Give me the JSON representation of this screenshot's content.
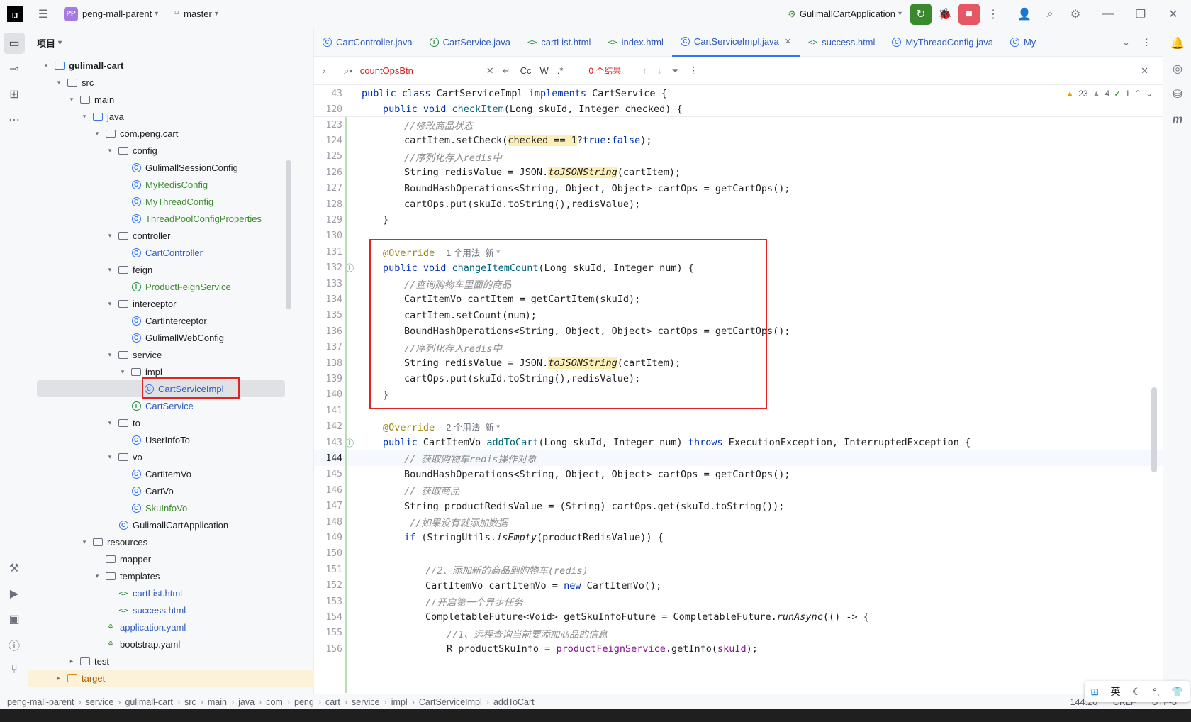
{
  "titlebar": {
    "project": "peng-mall-parent",
    "project_badge": "PP",
    "branch": "master",
    "run_config": "GulimallCartApplication"
  },
  "project_panel": {
    "title": "项目"
  },
  "tree": [
    {
      "label": "gulimall-cart",
      "depth": 0,
      "arrow": "v",
      "icon": "module",
      "cls": "bold"
    },
    {
      "label": "src",
      "depth": 1,
      "arrow": "v",
      "icon": "folder",
      "cls": ""
    },
    {
      "label": "main",
      "depth": 2,
      "arrow": "v",
      "icon": "folder",
      "cls": ""
    },
    {
      "label": "java",
      "depth": 3,
      "arrow": "v",
      "icon": "folder-blue",
      "cls": ""
    },
    {
      "label": "com.peng.cart",
      "depth": 4,
      "arrow": "v",
      "icon": "package",
      "cls": ""
    },
    {
      "label": "config",
      "depth": 5,
      "arrow": "v",
      "icon": "package",
      "cls": ""
    },
    {
      "label": "GulimallSessionConfig",
      "depth": 6,
      "arrow": "",
      "icon": "class",
      "cls": ""
    },
    {
      "label": "MyRedisConfig",
      "depth": 6,
      "arrow": "",
      "icon": "class",
      "cls": "green"
    },
    {
      "label": "MyThreadConfig",
      "depth": 6,
      "arrow": "",
      "icon": "class",
      "cls": "green"
    },
    {
      "label": "ThreadPoolConfigProperties",
      "depth": 6,
      "arrow": "",
      "icon": "class",
      "cls": "green"
    },
    {
      "label": "controller",
      "depth": 5,
      "arrow": "v",
      "icon": "package",
      "cls": ""
    },
    {
      "label": "CartController",
      "depth": 6,
      "arrow": "",
      "icon": "class",
      "cls": "blue"
    },
    {
      "label": "feign",
      "depth": 5,
      "arrow": "v",
      "icon": "package",
      "cls": ""
    },
    {
      "label": "ProductFeignService",
      "depth": 6,
      "arrow": "",
      "icon": "interface",
      "cls": "green"
    },
    {
      "label": "interceptor",
      "depth": 5,
      "arrow": "v",
      "icon": "package",
      "cls": ""
    },
    {
      "label": "CartInterceptor",
      "depth": 6,
      "arrow": "",
      "icon": "class",
      "cls": ""
    },
    {
      "label": "GulimallWebConfig",
      "depth": 6,
      "arrow": "",
      "icon": "class",
      "cls": ""
    },
    {
      "label": "service",
      "depth": 5,
      "arrow": "v",
      "icon": "package",
      "cls": ""
    },
    {
      "label": "impl",
      "depth": 6,
      "arrow": "v",
      "icon": "package",
      "cls": ""
    },
    {
      "label": "CartServiceImpl",
      "depth": 7,
      "arrow": "",
      "icon": "class",
      "cls": "blue selected"
    },
    {
      "label": "CartService",
      "depth": 6,
      "arrow": "",
      "icon": "interface",
      "cls": "blue"
    },
    {
      "label": "to",
      "depth": 5,
      "arrow": "v",
      "icon": "package",
      "cls": ""
    },
    {
      "label": "UserInfoTo",
      "depth": 6,
      "arrow": "",
      "icon": "class",
      "cls": ""
    },
    {
      "label": "vo",
      "depth": 5,
      "arrow": "v",
      "icon": "package",
      "cls": ""
    },
    {
      "label": "CartItemVo",
      "depth": 6,
      "arrow": "",
      "icon": "class",
      "cls": ""
    },
    {
      "label": "CartVo",
      "depth": 6,
      "arrow": "",
      "icon": "class",
      "cls": ""
    },
    {
      "label": "SkuInfoVo",
      "depth": 6,
      "arrow": "",
      "icon": "class",
      "cls": "green"
    },
    {
      "label": "GulimallCartApplication",
      "depth": 5,
      "arrow": "",
      "icon": "class",
      "cls": ""
    },
    {
      "label": "resources",
      "depth": 3,
      "arrow": "v",
      "icon": "folder",
      "cls": ""
    },
    {
      "label": "mapper",
      "depth": 4,
      "arrow": "",
      "icon": "folder",
      "cls": ""
    },
    {
      "label": "templates",
      "depth": 4,
      "arrow": "v",
      "icon": "folder",
      "cls": ""
    },
    {
      "label": "cartList.html",
      "depth": 5,
      "arrow": "",
      "icon": "html",
      "cls": "blue"
    },
    {
      "label": "success.html",
      "depth": 5,
      "arrow": "",
      "icon": "html",
      "cls": "blue"
    },
    {
      "label": "application.yaml",
      "depth": 4,
      "arrow": "",
      "icon": "yaml",
      "cls": "blue"
    },
    {
      "label": "bootstrap.yaml",
      "depth": 4,
      "arrow": "",
      "icon": "yaml",
      "cls": ""
    },
    {
      "label": "test",
      "depth": 2,
      "arrow": ">",
      "icon": "folder",
      "cls": ""
    },
    {
      "label": "target",
      "depth": 1,
      "arrow": ">",
      "icon": "folder-orange",
      "cls": "orange target"
    }
  ],
  "tabs": [
    {
      "label": "CartController.java",
      "icon": "C"
    },
    {
      "label": "CartService.java",
      "icon": "I"
    },
    {
      "label": "cartList.html",
      "icon": "<>"
    },
    {
      "label": "index.html",
      "icon": "<>"
    },
    {
      "label": "CartServiceImpl.java",
      "icon": "C",
      "active": true
    },
    {
      "label": "success.html",
      "icon": "<>"
    },
    {
      "label": "MyThreadConfig.java",
      "icon": "C"
    },
    {
      "label": "My",
      "icon": "C"
    }
  ],
  "search": {
    "query": "countOpsBtn",
    "results": "0 个结果",
    "opt_case": "Cc",
    "opt_word": "W",
    "opt_regex": ".*"
  },
  "inspections": {
    "warnings": "23",
    "weak": "4",
    "ok": "1"
  },
  "code_lines": [
    {
      "n": "43",
      "html": "<span class='kw'>public class</span> CartServiceImpl <span class='kw'>implements</span> CartService {",
      "indent": 0
    },
    {
      "n": "120",
      "html": "<span class='kw'>public void</span> <span class='fn'>checkItem</span>(Long skuId, Integer checked) {",
      "indent": 1
    },
    {
      "n": "123",
      "html": "<span class='cm'>//修改商品状态</span>",
      "indent": 2
    },
    {
      "n": "124",
      "html": "cartItem.setCheck(<span class='strhl'>checked == 1</span>?<span class='kw'>true</span>:<span class='kw'>false</span>);",
      "indent": 2
    },
    {
      "n": "125",
      "html": "<span class='cm'>//序列化存入redis中</span>",
      "indent": 2
    },
    {
      "n": "126",
      "html": "String redisValue = JSON.<span class='it strhl'>toJSONString</span>(cartItem);",
      "indent": 2
    },
    {
      "n": "127",
      "html": "BoundHashOperations&lt;String, Object, Object&gt; cartOps = getCartOps();",
      "indent": 2
    },
    {
      "n": "128",
      "html": "cartOps.put(skuId.toString(),redisValue);",
      "indent": 2
    },
    {
      "n": "129",
      "html": "}",
      "indent": 1
    },
    {
      "n": "130",
      "html": "",
      "indent": 0
    },
    {
      "n": "131",
      "html": "<span class='an'>@Override</span>  <span class='hint'>1 个用法  新 *</span>",
      "indent": 1
    },
    {
      "n": "132",
      "html": "<span class='kw'>public void</span> <span class='fn'>changeItemCount</span>(Long skuId, Integer num) {",
      "indent": 1
    },
    {
      "n": "133",
      "html": "<span class='cm'>//查询购物车里面的商品</span>",
      "indent": 2
    },
    {
      "n": "134",
      "html": "CartItemVo cartItem = getCartItem(skuId);",
      "indent": 2
    },
    {
      "n": "135",
      "html": "cartItem.setCount(num);",
      "indent": 2
    },
    {
      "n": "136",
      "html": "BoundHashOperations&lt;String, Object, Object&gt; cartOps = getCartOps();",
      "indent": 2
    },
    {
      "n": "137",
      "html": "<span class='cm'>//序列化存入redis中</span>",
      "indent": 2
    },
    {
      "n": "138",
      "html": "String redisValue = JSON.<span class='it strhl'>toJSONString</span>(cartItem);",
      "indent": 2
    },
    {
      "n": "139",
      "html": "cartOps.put(skuId.toString(),redisValue);",
      "indent": 2
    },
    {
      "n": "140",
      "html": "}",
      "indent": 1
    },
    {
      "n": "141",
      "html": "",
      "indent": 0
    },
    {
      "n": "142",
      "html": "<span class='an'>@Override</span>  <span class='hint'>2 个用法  新 *</span>",
      "indent": 1
    },
    {
      "n": "143",
      "html": "<span class='kw'>public</span> CartItemVo <span class='fn'>addToCart</span>(Long skuId, Integer num) <span class='kw'>throws</span> ExecutionException, InterruptedException {",
      "indent": 1
    },
    {
      "n": "144",
      "html": "<span class='cm'>// 获取购物车redis操作对象</span>",
      "indent": 2
    },
    {
      "n": "145",
      "html": "BoundHashOperations&lt;String, Object, Object&gt; cartOps = getCartOps();",
      "indent": 2
    },
    {
      "n": "146",
      "html": "<span class='cm'>// 获取商品</span>",
      "indent": 2
    },
    {
      "n": "147",
      "html": "String productRedisValue = (String) cartOps.get(skuId.toString());",
      "indent": 2
    },
    {
      "n": "148",
      "html": " <span class='cm'>//如果没有就添加数据</span>",
      "indent": 2
    },
    {
      "n": "149",
      "html": "<span class='kw'>if</span> (StringUtils.<span class='it'>isEmpty</span>(productRedisValue)) {",
      "indent": 2
    },
    {
      "n": "150",
      "html": "",
      "indent": 0
    },
    {
      "n": "151",
      "html": "<span class='cm'>//2、添加新的商品到购物车(redis)</span>",
      "indent": 3
    },
    {
      "n": "152",
      "html": "CartItemVo cartItemVo = <span class='kw'>new</span> CartItemVo();",
      "indent": 3
    },
    {
      "n": "153",
      "html": "<span class='cm'>//开启第一个异步任务</span>",
      "indent": 3
    },
    {
      "n": "154",
      "html": "CompletableFuture&lt;Void&gt; getSkuInfoFuture = CompletableFuture.<span class='it'>runAsync</span>(() -&gt; {",
      "indent": 3
    },
    {
      "n": "155",
      "html": "<span class='cm'>//1、远程查询当前要添加商品的信息</span>",
      "indent": 4
    },
    {
      "n": "156",
      "html": "R productSkuInfo = <span style='color:#871094'>productFeignService</span>.getInfo(<span style='color:#871094'>skuId</span>);",
      "indent": 4
    }
  ],
  "statusbar": {
    "crumbs": [
      "peng-mall-parent",
      "service",
      "gulimall-cart",
      "src",
      "main",
      "java",
      "com",
      "peng",
      "cart",
      "service",
      "impl",
      "CartServiceImpl",
      "addToCart"
    ],
    "position": "144:26",
    "line_sep": "CRLF",
    "encoding": "UTF-8"
  },
  "ime": {
    "lang": "英"
  }
}
